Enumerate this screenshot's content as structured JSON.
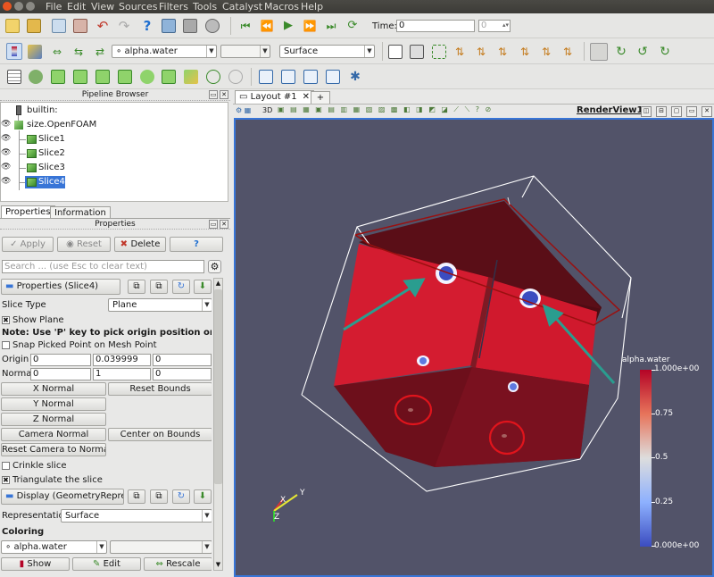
{
  "menubar": {
    "items": [
      "File",
      "Edit",
      "View",
      "Sources",
      "Filters",
      "Tools",
      "Catalyst",
      "Macros",
      "Help"
    ]
  },
  "toolbar": {
    "time_label": "Time:",
    "time_value": "0",
    "time_step": "0",
    "array_combo": "alpha.water",
    "array_combo_icon": "point-data-icon",
    "component_combo": "",
    "representation_combo": "Surface"
  },
  "pipeline": {
    "title": "Pipeline Browser",
    "items": [
      {
        "label": "builtin:",
        "icon": "server-icon"
      },
      {
        "label": "size.OpenFOAM",
        "icon": "reader-icon"
      },
      {
        "label": "Slice1",
        "icon": "slice-icon"
      },
      {
        "label": "Slice2",
        "icon": "slice-icon"
      },
      {
        "label": "Slice3",
        "icon": "slice-icon"
      },
      {
        "label": "Slice4",
        "icon": "slice-icon",
        "selected": true
      }
    ]
  },
  "properties_tabs": [
    "Properties",
    "Information"
  ],
  "properties": {
    "title": "Properties",
    "apply": "Apply",
    "reset": "Reset",
    "delete": "Delete",
    "help": "?",
    "search_placeholder": "Search ... (use Esc to clear text)",
    "section_title": "Properties (Slice4)",
    "slice_type_label": "Slice Type",
    "slice_type_value": "Plane",
    "show_plane": "Show Plane",
    "note": "Note: Use 'P' key to pick origin position on mesh",
    "snap": "Snap Picked Point on Mesh Point",
    "origin_label": "Origin",
    "origin": [
      "0",
      "0.039999",
      "0"
    ],
    "normal_label": "Normal",
    "normal": [
      "0",
      "1",
      "0"
    ],
    "x_normal": "X Normal",
    "y_normal": "Y Normal",
    "z_normal": "Z Normal",
    "reset_bounds": "Reset Bounds",
    "camera_normal": "Camera Normal",
    "center_on_bounds": "Center on Bounds",
    "reset_camera": "Reset Camera to Normal",
    "crinkle": "Crinkle slice",
    "triangulate": "Triangulate the slice",
    "display_title": "Display (GeometryRepres",
    "representation_label": "Representation",
    "representation_value": "Surface",
    "coloring_label": "Coloring",
    "coloring_value": "alpha.water",
    "show": "Show",
    "edit": "Edit",
    "rescale": "Rescale"
  },
  "layout": {
    "tab_label": "Layout #1",
    "add_tab": "+",
    "view_label": "RenderView1",
    "view_toolbar_text": "3D"
  },
  "colorbar": {
    "title": "alpha.water",
    "ticks": [
      "1.000e+00",
      "0.75",
      "0.5",
      "0.25",
      "0.000e+00"
    ],
    "colors": {
      "top": "#b40426",
      "mid": "#dddddd",
      "bottom": "#3b4cc0"
    }
  },
  "axes": {
    "x": "X",
    "y": "Y",
    "z": "Z"
  },
  "colors": {
    "background": "#525369",
    "accent": "#3875d7",
    "arrow": "#2a9d8f",
    "circle": "#e0141c"
  }
}
